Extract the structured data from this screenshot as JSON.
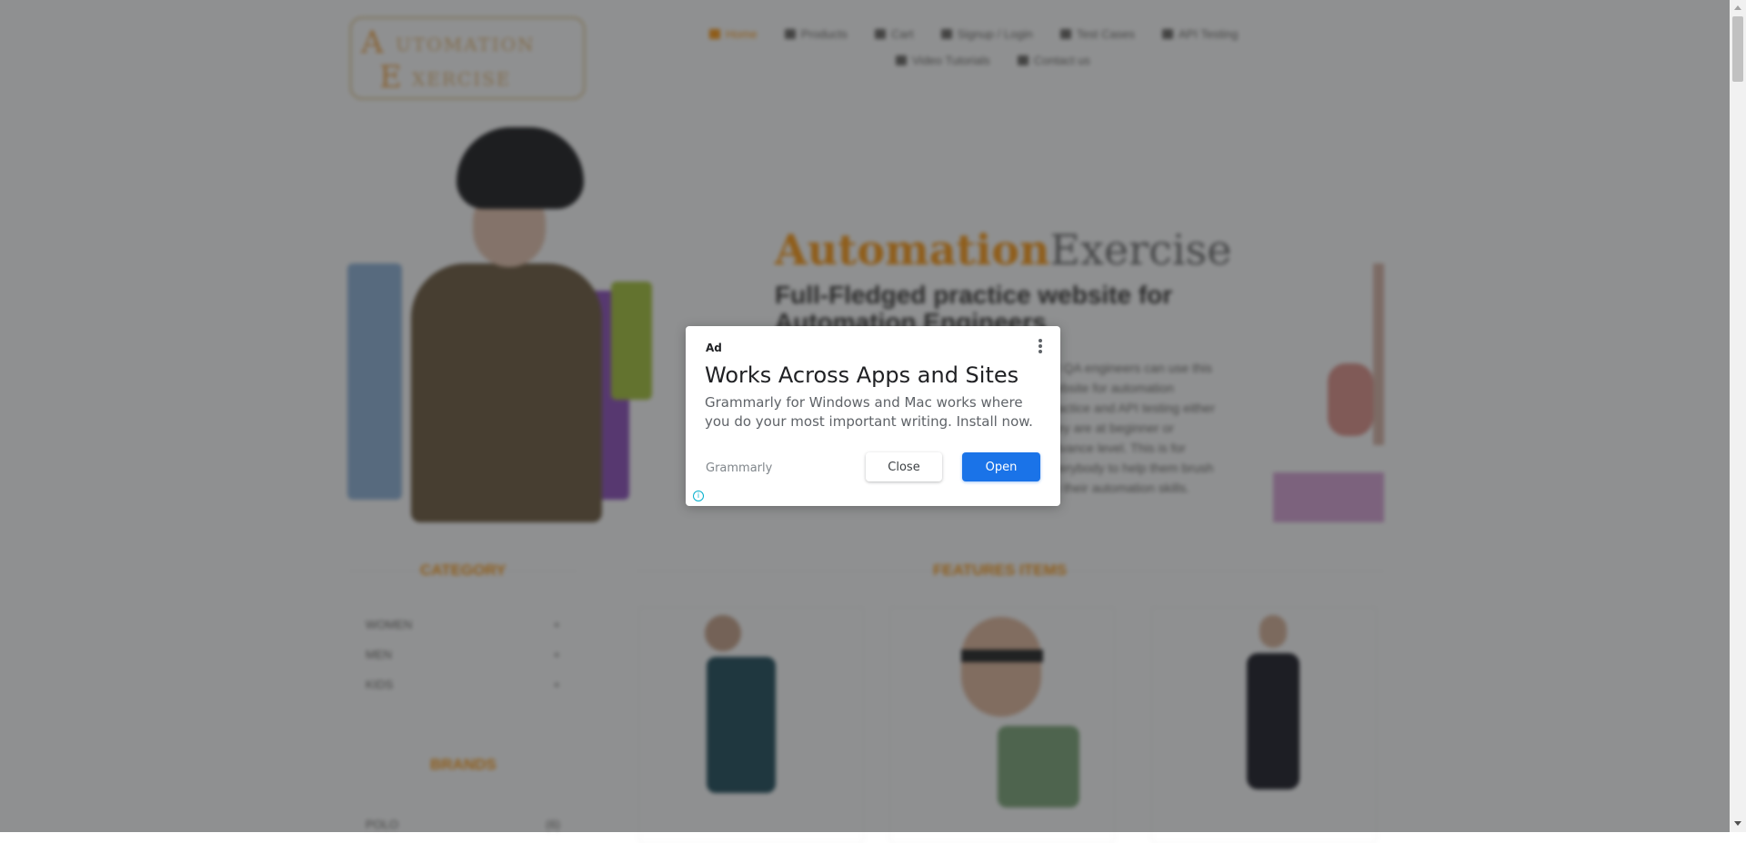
{
  "site": {
    "logo": {
      "line1_initial": "A",
      "line1_rest": "UTOMATION",
      "line2_initial": "E",
      "line2_rest": "XERCISE"
    },
    "nav": [
      {
        "label": "Home",
        "icon": "home-icon",
        "active": true
      },
      {
        "label": "Products",
        "icon": "products-icon",
        "active": false
      },
      {
        "label": "Cart",
        "icon": "cart-icon",
        "active": false
      },
      {
        "label": "Signup / Login",
        "icon": "lock-icon",
        "active": false
      },
      {
        "label": "Test Cases",
        "icon": "list-icon",
        "active": false
      },
      {
        "label": "API Testing",
        "icon": "list-icon",
        "active": false
      },
      {
        "label": "Video Tutorials",
        "icon": "youtube-icon",
        "active": false
      },
      {
        "label": "Contact us",
        "icon": "envelope-icon",
        "active": false
      }
    ],
    "hero": {
      "title_part1": "Automation",
      "title_part2": "Exercise",
      "subtitle": "Full-Fledged practice website for Automation Engineers",
      "text": "All QA engineers can use this website for automation practice and API testing either they are at beginner or advance level. This is for everybody to help them brush up their automation skills."
    },
    "category_title": "CATEGORY",
    "categories": [
      {
        "label": "WOMEN",
        "toggle": "+"
      },
      {
        "label": "MEN",
        "toggle": "+"
      },
      {
        "label": "KIDS",
        "toggle": "+"
      }
    ],
    "brands_title": "BRANDS",
    "brands": [
      {
        "label": "POLO",
        "count": "(6)"
      }
    ],
    "featured_title": "FEATURES ITEMS"
  },
  "ad": {
    "label": "Ad",
    "title": "Works Across Apps and Sites",
    "description": "Grammarly for Windows and Mac works where you do your most important writing. Install now.",
    "advertiser": "Grammarly",
    "close_label": "Close",
    "open_label": "Open",
    "info_icon": "i"
  },
  "colors": {
    "accent": "#fe980f",
    "open_button": "#1a73e8",
    "info": "#00aecd"
  }
}
